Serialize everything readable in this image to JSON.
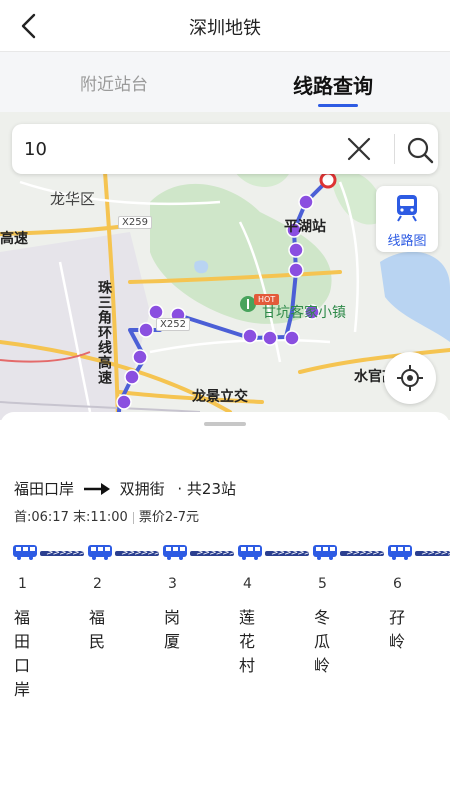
{
  "header": {
    "title": "深圳地铁"
  },
  "tabs": [
    {
      "label": "附近站台",
      "active": false
    },
    {
      "label": "线路查询",
      "active": true
    }
  ],
  "search": {
    "value": "10",
    "placeholder": ""
  },
  "map": {
    "route_map_label": "线路图",
    "labels": {
      "longhua": "龙华区",
      "x259": "X259",
      "pinghu": "平湖站",
      "highway": "高速",
      "ring": "珠三角环线高速",
      "x252": "X252",
      "hakka": "甘坑客家小镇",
      "longjing": "龙景立交",
      "shuiguan": "水官高速",
      "hot": "HOT"
    }
  },
  "line": {
    "from": "福田口岸",
    "to": "双拥街",
    "total": "· 共23站",
    "first_last": "首:06:17 末:11:00",
    "fare": "票价2-7元"
  },
  "stations": [
    {
      "num": "1",
      "name": "福田口岸"
    },
    {
      "num": "2",
      "name": "福民"
    },
    {
      "num": "3",
      "name": "岗厦"
    },
    {
      "num": "4",
      "name": "莲花村"
    },
    {
      "num": "5",
      "name": "冬瓜岭"
    },
    {
      "num": "6",
      "name": "孖岭"
    }
  ],
  "colors": {
    "accent": "#2d5be3",
    "route": "#4b5fd6",
    "stop": "#8a4fe0",
    "track": "#2b3f8f"
  }
}
